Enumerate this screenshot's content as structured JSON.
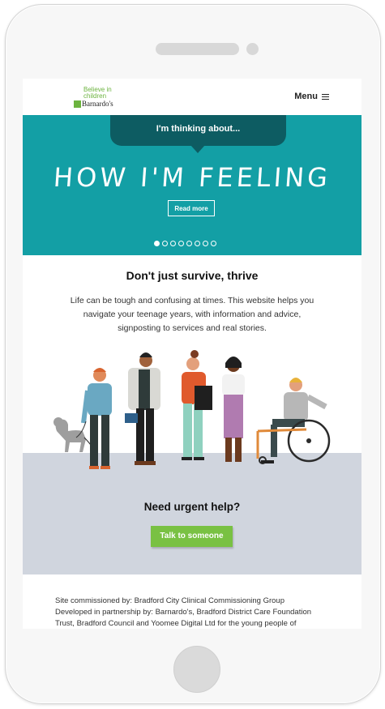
{
  "header": {
    "logo_line1": "Believe in",
    "logo_line2": "children",
    "logo_brand": "Barnardo's",
    "menu_label": "Menu"
  },
  "hero": {
    "bubble_text": "I'm thinking about...",
    "title": "HOW I'M FEELING",
    "read_more": "Read more",
    "slide_count": 8,
    "active_slide": 1
  },
  "intro": {
    "title": "Don't just survive, thrive",
    "text": "Life can be tough and confusing at times. This website helps you navigate your teenage years, with information and advice, signposting to services and real stories."
  },
  "urgent": {
    "title": "Need urgent help?",
    "button": "Talk to someone"
  },
  "footer": {
    "line1": "Site commissioned by: Bradford City Clinical Commissioning Group",
    "line2": "Developed in partnership by: Barnardo's, Bradford District Care Foundation Trust, Bradford Council and Yoomee Digital Ltd for the young people of"
  },
  "colors": {
    "hero_bg": "#139fa5",
    "bubble_bg": "#0d5c62",
    "brand_green": "#6cb33f",
    "button_green": "#79c143",
    "band_grey": "#d0d5de"
  },
  "icons": [
    "menu-icon",
    "logo-mark"
  ]
}
